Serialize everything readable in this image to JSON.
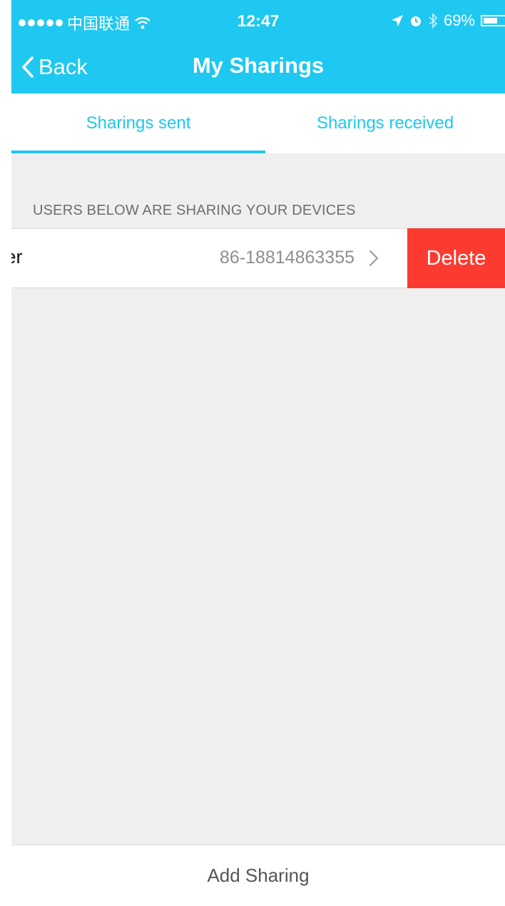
{
  "status_bar": {
    "carrier": "中国联通",
    "time": "12:47",
    "battery": "69%",
    "battery_level": 0.69,
    "icons": [
      "signal-dots-icon",
      "wifi-icon",
      "location-icon",
      "alarm-icon",
      "bluetooth-icon",
      "battery-icon"
    ]
  },
  "nav": {
    "back_label": "Back",
    "title": "My Sharings"
  },
  "tabs": [
    {
      "label": "Sharings sent",
      "selected": true
    },
    {
      "label": "Sharings received",
      "selected": false
    }
  ],
  "section": {
    "header": "USERS BELOW ARE SHARING YOUR DEVICES"
  },
  "rows": [
    {
      "name": "ser",
      "phone": "86-18814863355",
      "action": "Delete"
    }
  ],
  "footer": {
    "add_label": "Add Sharing"
  },
  "colors": {
    "accent": "#1ec8f0",
    "delete": "#fb3b30",
    "background": "#efefef"
  }
}
